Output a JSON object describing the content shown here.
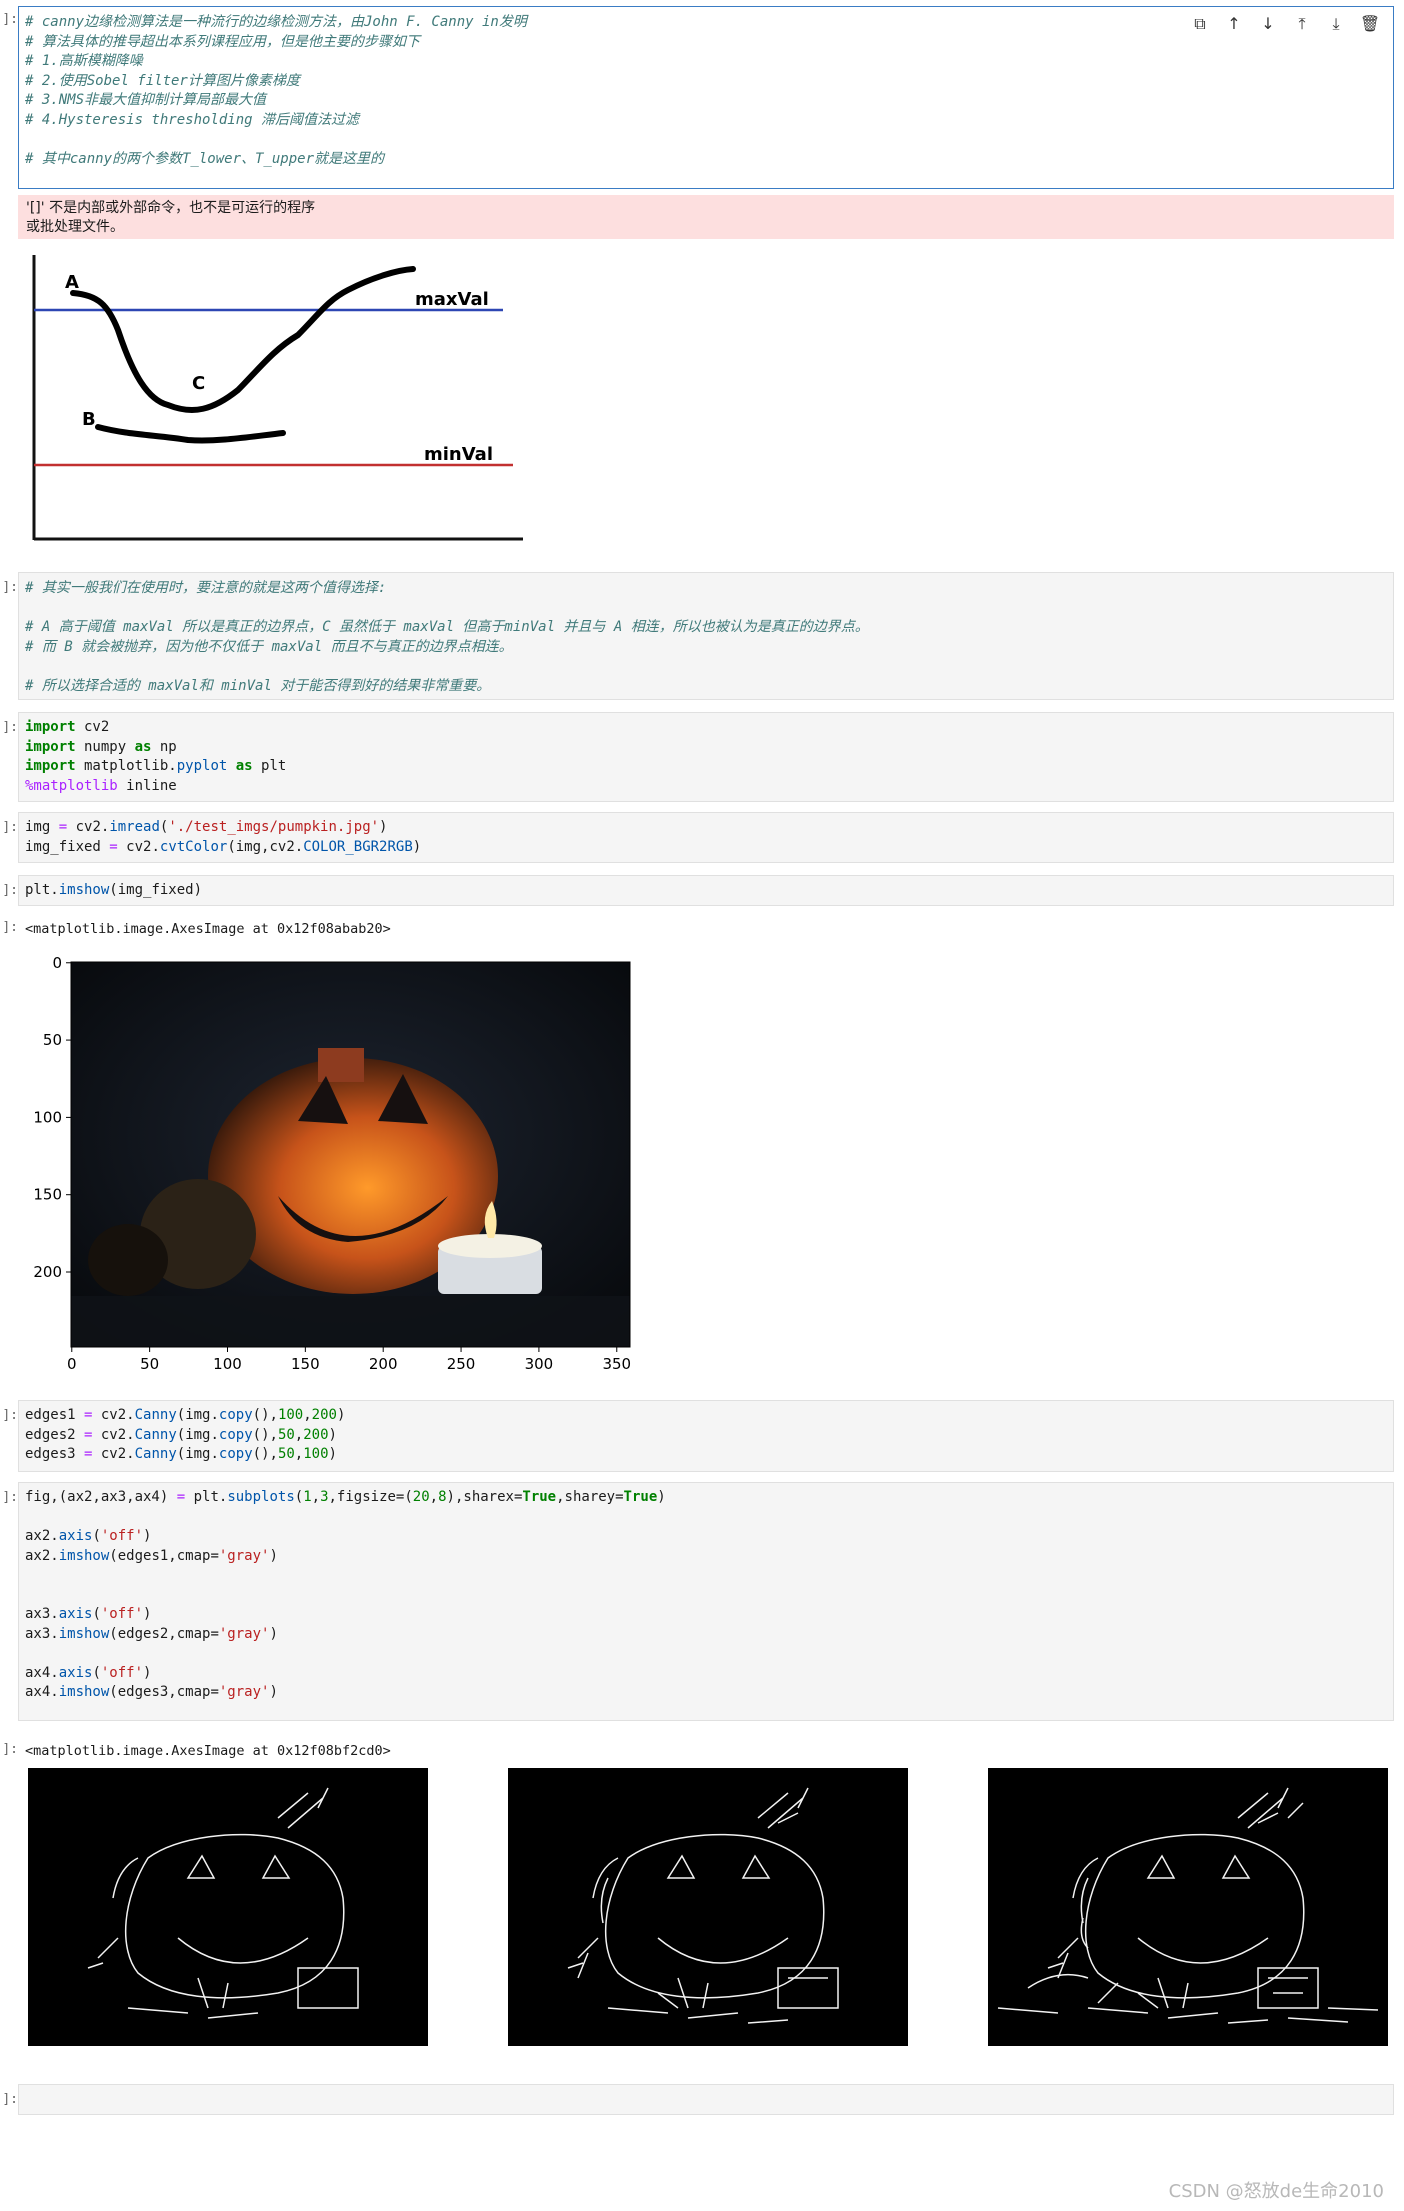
{
  "cells": {
    "md_comment": {
      "prompt": "]:",
      "lines": [
        "# canny边缘检测算法是一种流行的边缘检测方法，由John F. Canny in发明",
        "# 算法具体的推导超出本系列课程应用，但是他主要的步骤如下",
        "# 1.高斯模糊降噪",
        "# 2.使用Sobel filter计算图片像素梯度",
        "# 3.NMS非最大值抑制计算局部最大值",
        "# 4.Hysteresis thresholding 滞后阈值法过滤",
        "",
        "# 其中canny的两个参数T_lower、T_upper就是这里的"
      ]
    },
    "error_output": {
      "line1": "'[]' 不是内部或外部命令，也不是可运行的程序",
      "line2": "或批处理文件。"
    },
    "diagram": {
      "label_a": "A",
      "label_b": "B",
      "label_c": "C",
      "max_label": "maxVal",
      "min_label": "minVal"
    },
    "comment2": {
      "prompt": "]:",
      "lines": [
        "# 其实一般我们在使用时，要注意的就是这两个值得选择:",
        "",
        "# A 高于阈值 maxVal 所以是真正的边界点，C 虽然低于 maxVal 但高于minVal 并且与 A 相连，所以也被认为是真正的边界点。",
        "# 而 B 就会被抛弃，因为他不仅低于 maxVal 而且不与真正的边界点相连。",
        "",
        "# 所以选择合适的 maxVal和 minVal 对于能否得到好的结果非常重要。"
      ]
    },
    "imports": {
      "prompt": "]:",
      "lines": [
        "import cv2",
        "import numpy as np",
        "import matplotlib.pyplot as plt",
        "%matplotlib inline"
      ]
    },
    "read": {
      "prompt": "]:",
      "lines": [
        "img = cv2.imread('./test_imgs/pumpkin.jpg')",
        "img_fixed = cv2.cvtColor(img,cv2.COLOR_BGR2RGB)"
      ]
    },
    "show": {
      "prompt": "]:",
      "lines": [
        "plt.imshow(img_fixed)"
      ],
      "output_prompt": "]:",
      "output": "<matplotlib.image.AxesImage at 0x12f08abab20>"
    },
    "canny": {
      "prompt": "]:",
      "lines": [
        "edges1 = cv2.Canny(img.copy(),100,200)",
        "edges2 = cv2.Canny(img.copy(),50,200)",
        "edges3 = cv2.Canny(img.copy(),50,100)"
      ]
    },
    "subplots": {
      "prompt": "]:",
      "lines": [
        "fig,(ax2,ax3,ax4) = plt.subplots(1,3,figsize=(20,8),sharex=True,sharey=True)",
        "",
        "ax2.axis('off')",
        "ax2.imshow(edges1,cmap='gray')",
        "",
        "",
        "ax3.axis('off')",
        "ax3.imshow(edges2,cmap='gray')",
        "",
        "ax4.axis('off')",
        "ax4.imshow(edges3,cmap='gray')"
      ],
      "output_prompt": "]:",
      "output": "<matplotlib.image.AxesImage at 0x12f08bf2cd0>"
    },
    "empty": {
      "prompt": "]:"
    }
  },
  "toolbar": {
    "icons": [
      "copy-icon",
      "move-up-icon",
      "move-down-icon",
      "insert-above-icon",
      "insert-below-icon",
      "delete-icon"
    ]
  },
  "plot_axes": {
    "x_ticks": [
      "0",
      "50",
      "100",
      "150",
      "200",
      "250",
      "300",
      "350"
    ],
    "y_ticks": [
      "0",
      "50",
      "100",
      "150",
      "200"
    ]
  },
  "watermark": "CSDN @怒放de生命2010"
}
